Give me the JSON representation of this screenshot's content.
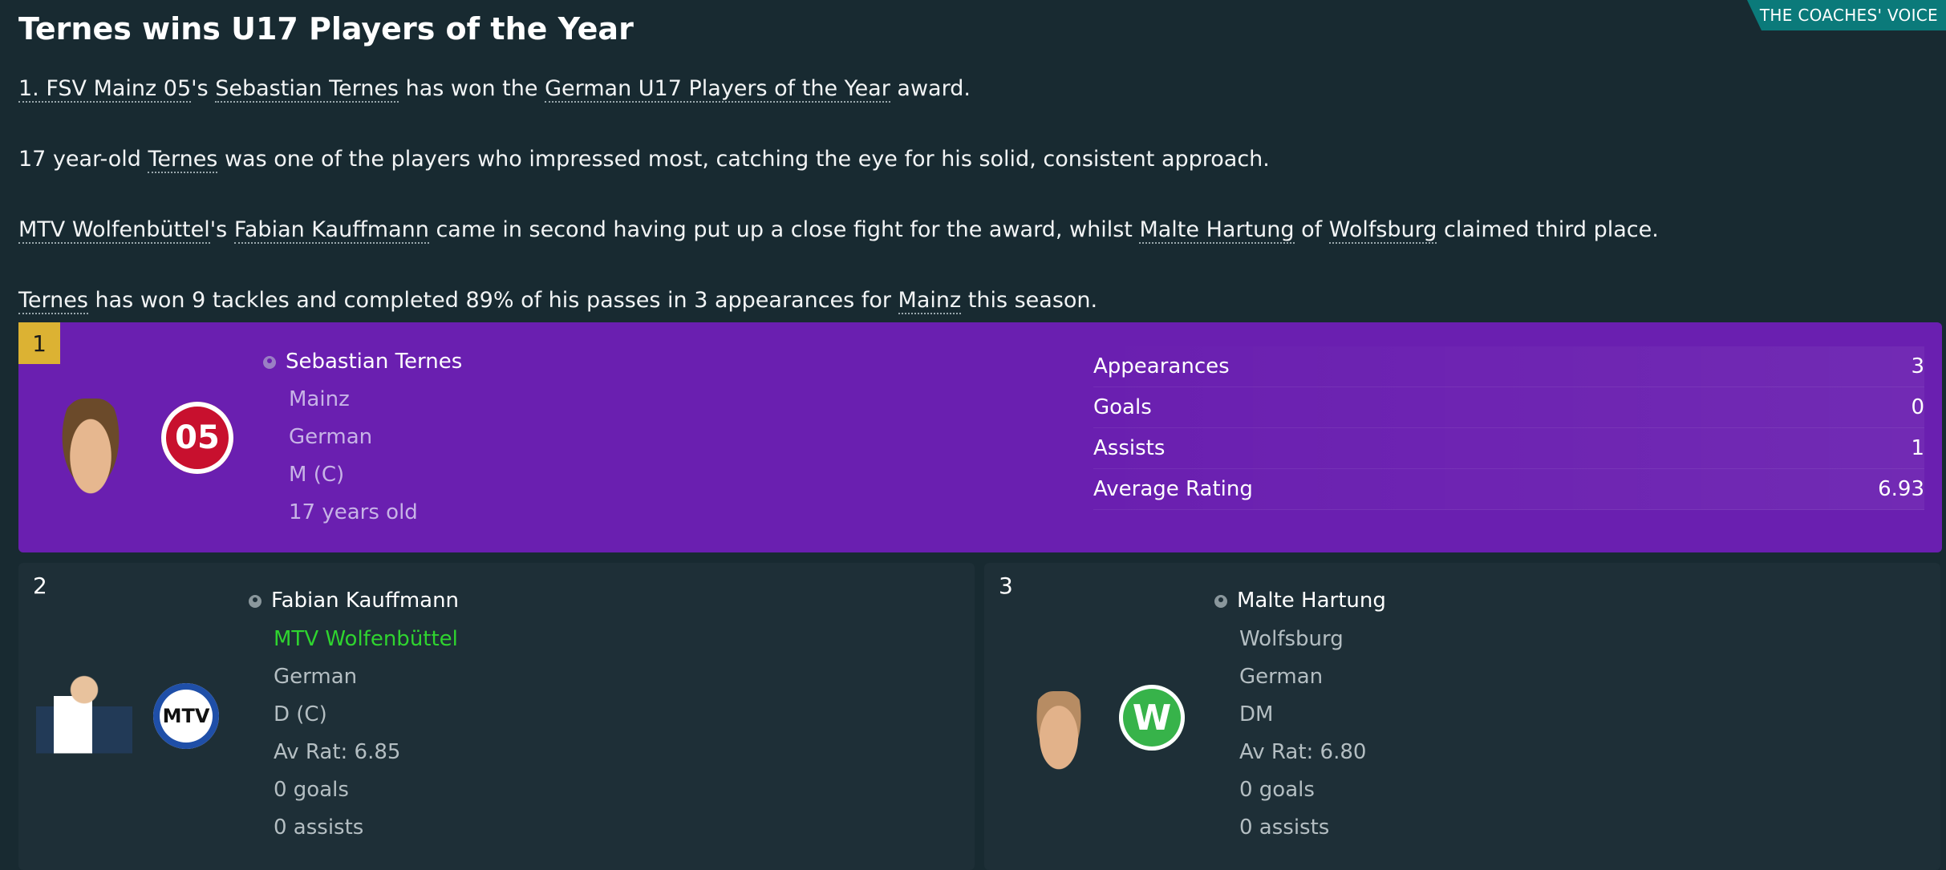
{
  "header": {
    "tag": "THE COACHES' VOICE",
    "title": "Ternes wins U17 Players of the Year"
  },
  "article": {
    "p1": {
      "club": "1. FSV Mainz 05",
      "a": "'s ",
      "player": "Sebastian Ternes",
      "b": " has won the ",
      "award": "German U17 Players of the Year",
      "c": " award."
    },
    "p2": {
      "a": "17 year-old ",
      "player": "Ternes",
      "b": " was one of the players who impressed most, catching the eye for his solid, consistent approach."
    },
    "p3": {
      "club": "MTV Wolfenbüttel",
      "a": "'s ",
      "player": "Fabian Kauffmann",
      "b": " came in second having put up a close fight for the award, whilst ",
      "player2": "Malte Hartung",
      "c": " of ",
      "club2": "Wolfsburg",
      "d": " claimed third place."
    },
    "p4": {
      "player": "Ternes",
      "a": " has won 9 tackles and completed 89% of his passes in 3 appearances for ",
      "club": "Mainz",
      "b": " this season."
    }
  },
  "winner": {
    "rank": "1",
    "name": "Sebastian Ternes",
    "club": "Mainz",
    "nationality": "German",
    "position": "M (C)",
    "age": "17 years old",
    "crest_text": "05",
    "stats": [
      {
        "label": "Appearances",
        "value": "3"
      },
      {
        "label": "Goals",
        "value": "0"
      },
      {
        "label": "Assists",
        "value": "1"
      },
      {
        "label": "Average Rating",
        "value": "6.93"
      }
    ]
  },
  "runners": [
    {
      "rank": "2",
      "name": "Fabian Kauffmann",
      "club": "MTV Wolfenbüttel",
      "nationality": "German",
      "position": "D (C)",
      "rating": "Av Rat: 6.85",
      "goals": "0 goals",
      "assists": "0 assists",
      "crest_text": "MTV"
    },
    {
      "rank": "3",
      "name": "Malte Hartung",
      "club": "Wolfsburg",
      "nationality": "German",
      "position": "DM",
      "rating": "Av Rat: 6.80",
      "goals": "0 goals",
      "assists": "0 assists",
      "crest_text": "W"
    }
  ],
  "colors": {
    "winner_bg": "#6a1fb0",
    "rank1_badge": "#dcb233",
    "tag_bg": "#0b7a7a",
    "highlight_club": "#2fd42f"
  },
  "icons": [
    "person-icon",
    "club-crest"
  ]
}
